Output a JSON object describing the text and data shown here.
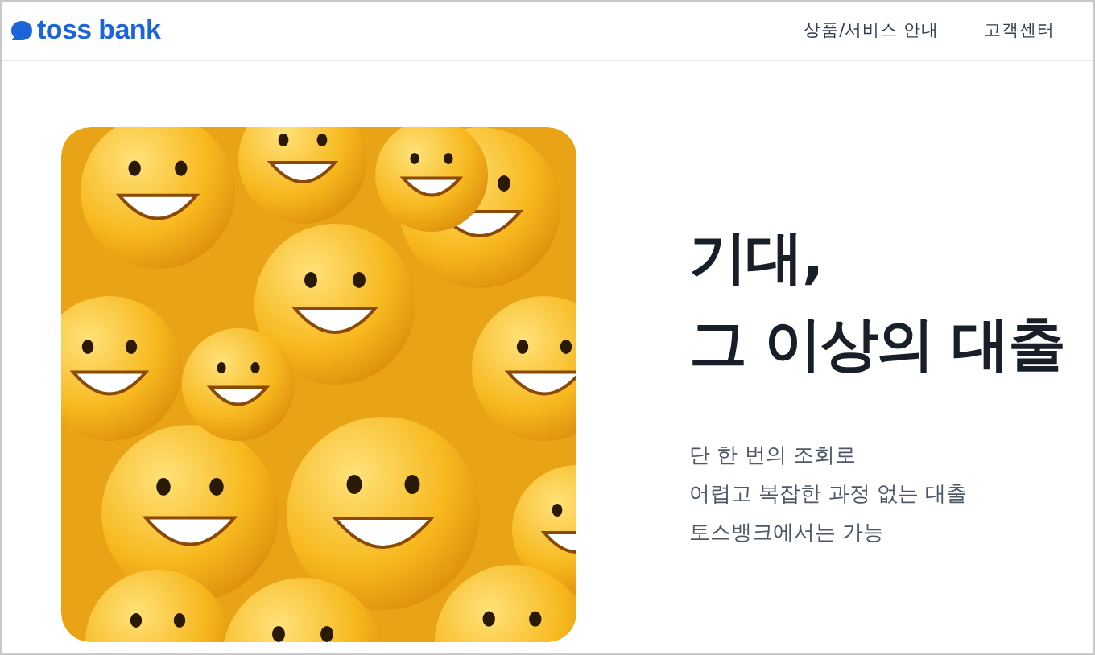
{
  "header": {
    "logo": "toss bank",
    "nav": [
      {
        "label": "상품/서비스 안내"
      },
      {
        "label": "고객센터"
      }
    ]
  },
  "hero": {
    "headline": [
      "기대,",
      "그 이상의 대출"
    ],
    "description": [
      "단 한 번의 조회로",
      "어렵고 복잡한 과정 없는 대출",
      "토스뱅크에서는 가능"
    ]
  }
}
